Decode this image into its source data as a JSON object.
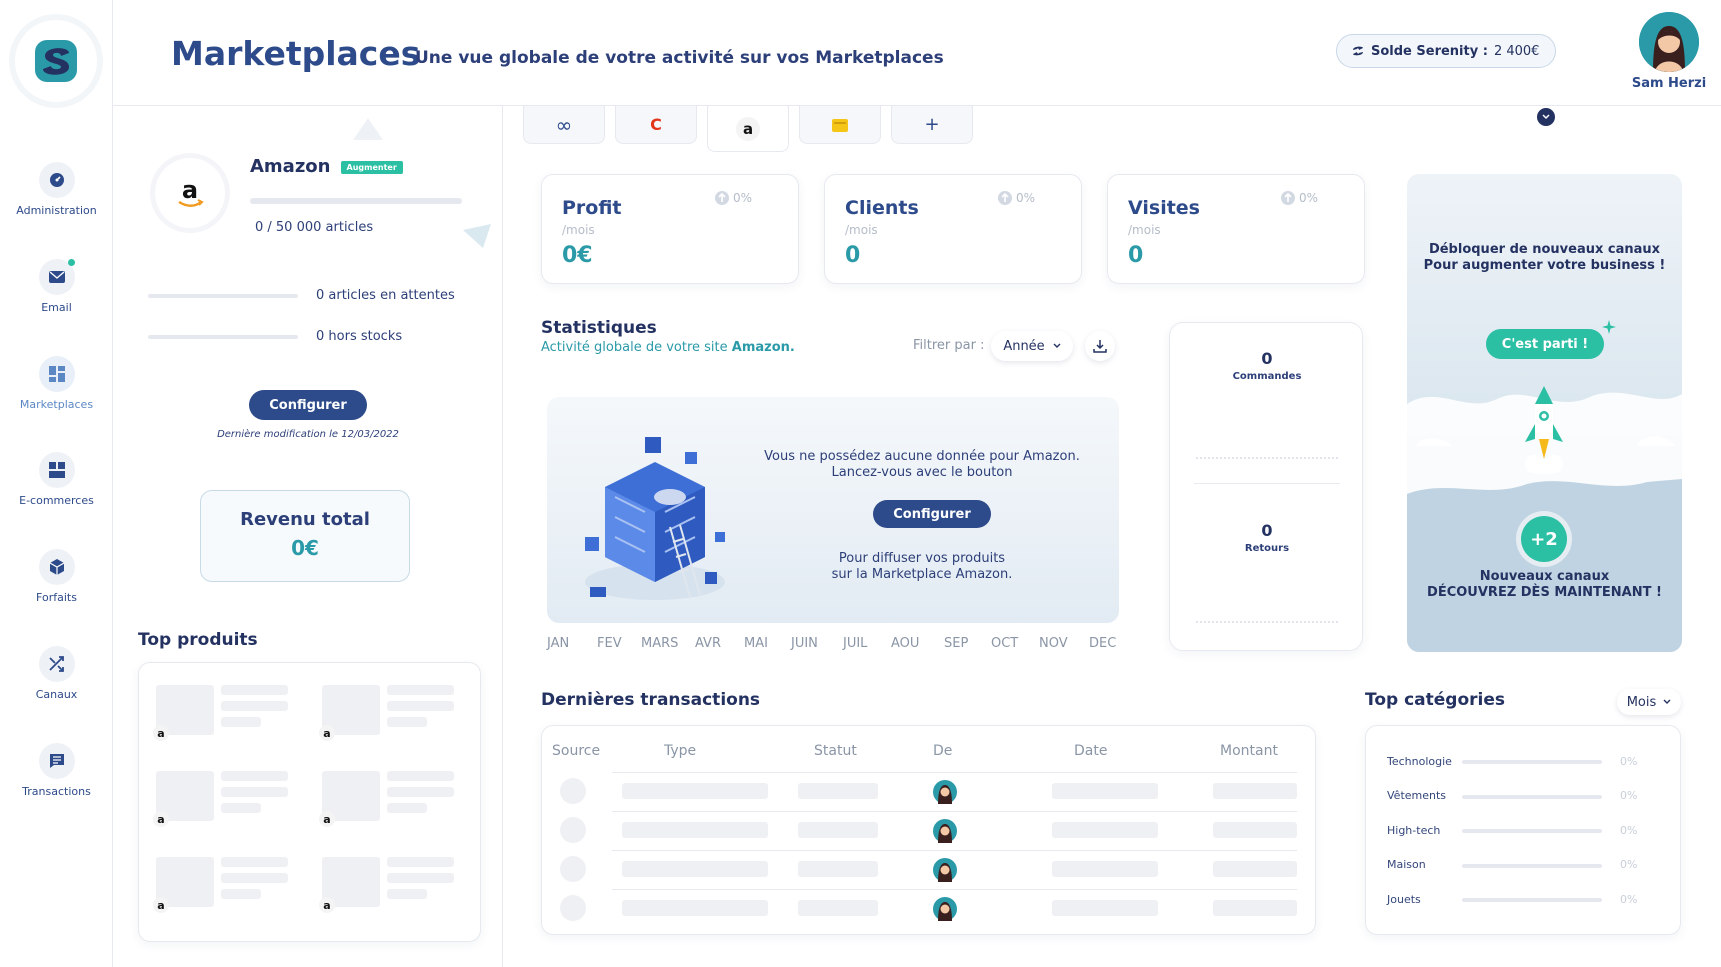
{
  "nav": {
    "items": [
      {
        "label": "Administration",
        "icon": "dashboard-icon"
      },
      {
        "label": "Email",
        "icon": "mail-icon"
      },
      {
        "label": "Marketplaces",
        "icon": "grid-icon"
      },
      {
        "label": "E-commerces",
        "icon": "layout-icon"
      },
      {
        "label": "Forfaits",
        "icon": "cube-icon"
      },
      {
        "label": "Canaux",
        "icon": "shuffle-icon"
      },
      {
        "label": "Transactions",
        "icon": "chat-list-icon"
      }
    ],
    "active": "Marketplaces"
  },
  "header": {
    "title": "Marketplaces",
    "subtitle": "Une vue globale de votre activité sur vos Marketplaces",
    "balance_label": "Solde Serenity :",
    "balance_value": "2 400€",
    "user_name": "Sam Herzi"
  },
  "marketplace": {
    "name": "Amazon",
    "badge": "Augmenter",
    "articles": "0 / 50 000 articles",
    "pending": "0 articles en attentes",
    "out_of_stock": "0 hors stocks",
    "configure": "Configurer",
    "last_modified": "Dernière modification le 12/03/2022",
    "revenue_label": "Revenu total",
    "revenue_value": "0€"
  },
  "top_products": {
    "title": "Top produits",
    "marker": "a"
  },
  "tabs": [
    {
      "icon": "infinity-icon",
      "glyph": "∞"
    },
    {
      "icon": "cdiscount-icon",
      "glyph": "C"
    },
    {
      "icon": "amazon-icon",
      "glyph": "a"
    },
    {
      "icon": "folder-icon",
      "glyph": ""
    },
    {
      "icon": "plus-icon",
      "glyph": "+"
    }
  ],
  "stats": [
    {
      "title": "Profit",
      "unit": "/mois",
      "value": "0€",
      "pct": "0%"
    },
    {
      "title": "Clients",
      "unit": "/mois",
      "value": "0",
      "pct": "0%"
    },
    {
      "title": "Visites",
      "unit": "/mois",
      "value": "0",
      "pct": "0%"
    }
  ],
  "statistics": {
    "title": "Statistiques",
    "subtitle_prefix": "Activité globale de votre site",
    "subtitle_site": "Amazon.",
    "filter_label": "Filtrer par :",
    "filter_value": "Année",
    "empty_line1": "Vous ne possédez aucune donnée pour Amazon.",
    "empty_line2": "Lancez-vous avec le bouton",
    "empty_button": "Configurer",
    "empty_line3": "Pour diffuser vos produits",
    "empty_line4": "sur la Marketplace Amazon.",
    "months": [
      "JAN",
      "FEV",
      "MARS",
      "AVR",
      "MAI",
      "JUIN",
      "JUIL",
      "AOU",
      "SEP",
      "OCT",
      "NOV",
      "DEC"
    ]
  },
  "orders": {
    "commandes_value": "0",
    "commandes_label": "Commandes",
    "retours_value": "0",
    "retours_label": "Retours"
  },
  "promo": {
    "line1": "Débloquer de nouveaux canaux",
    "line2": "Pour augmenter votre business !",
    "button": "C'est parti !",
    "count": "+2",
    "line3": "Nouveaux canaux",
    "line4": "DÉCOUVREZ DÈS MAINTENANT !"
  },
  "transactions": {
    "title": "Dernières transactions",
    "columns": [
      "Source",
      "Type",
      "Statut",
      "De",
      "Date",
      "Montant"
    ]
  },
  "categories": {
    "title": "Top catégories",
    "filter_value": "Mois",
    "items": [
      {
        "label": "Technologie",
        "pct": "0%"
      },
      {
        "label": "Vêtements",
        "pct": "0%"
      },
      {
        "label": "High-tech",
        "pct": "0%"
      },
      {
        "label": "Maison",
        "pct": "0%"
      },
      {
        "label": "Jouets",
        "pct": "0%"
      }
    ]
  },
  "colors": {
    "primary": "#2d4a8a",
    "accent": "#2b9aa8",
    "success": "#2bbfa4"
  }
}
